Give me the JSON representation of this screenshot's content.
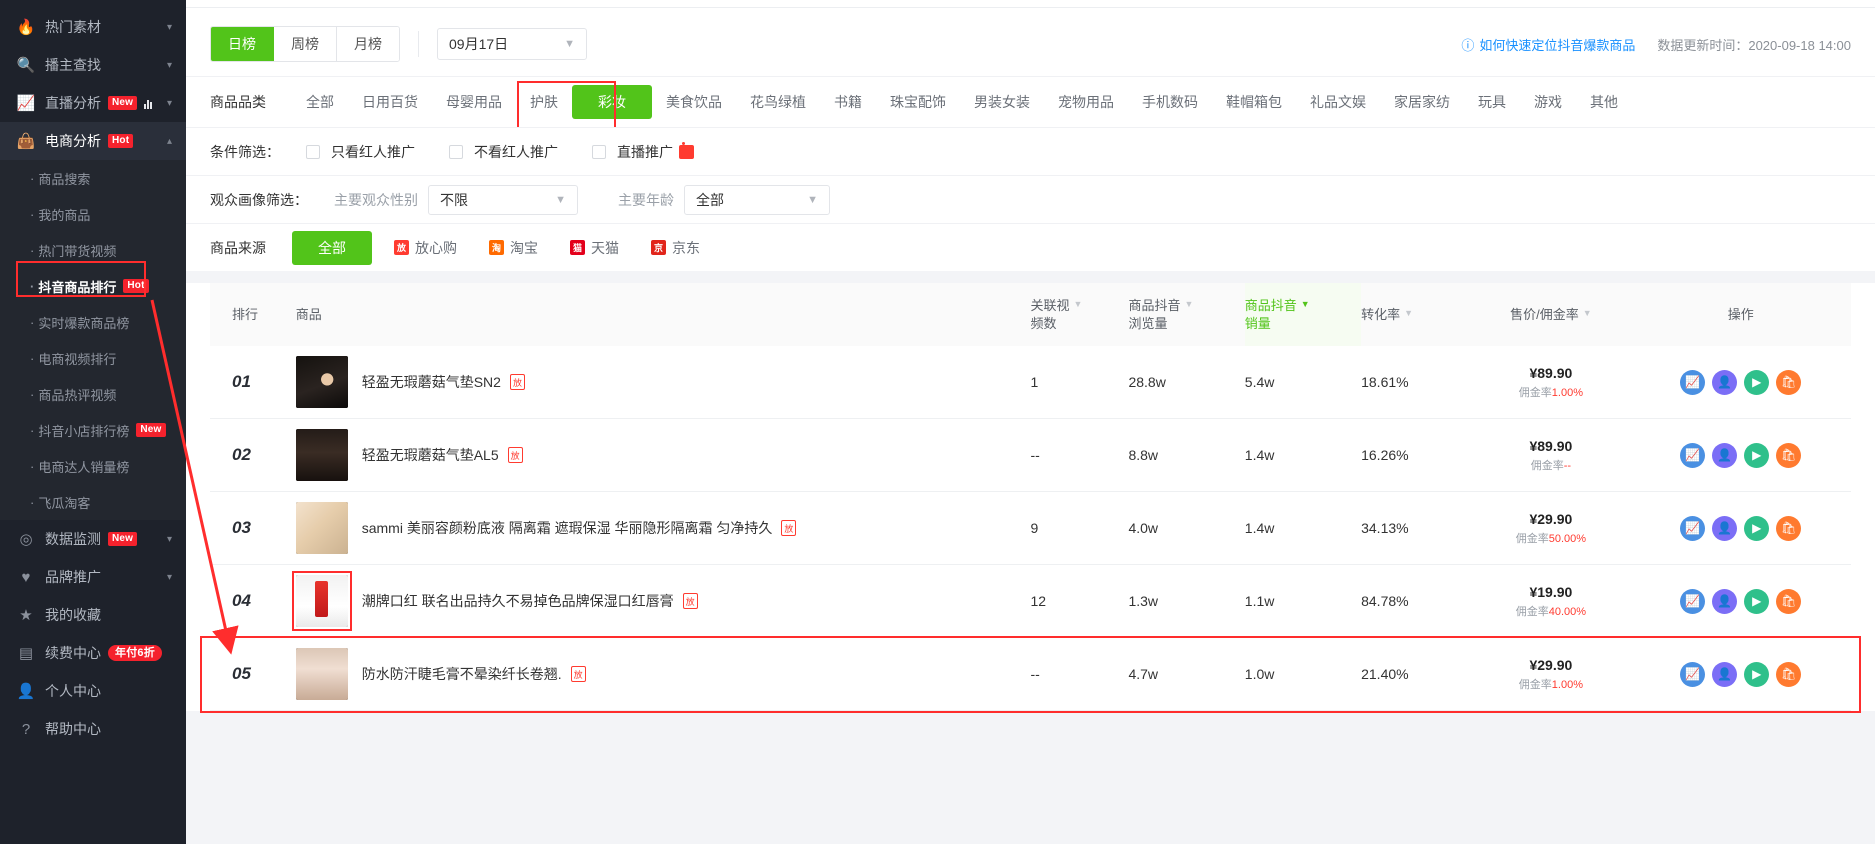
{
  "sidebar": {
    "groups": [
      {
        "label": "热门素材",
        "icon": "flame-icon",
        "badge": "",
        "caret": "▾",
        "active": false
      },
      {
        "label": "播主查找",
        "icon": "search-icon",
        "badge": "",
        "caret": "▾",
        "active": false
      },
      {
        "label": "直播分析",
        "icon": "trend-icon",
        "badge": "New",
        "caret": "▾",
        "active": false
      },
      {
        "label": "电商分析",
        "icon": "bag-icon",
        "badge": "Hot",
        "caret": "▴",
        "active": true
      }
    ],
    "sub_items": [
      {
        "label": "商品搜索",
        "badge": "",
        "selected": false
      },
      {
        "label": "我的商品",
        "badge": "",
        "selected": false
      },
      {
        "label": "热门带货视频",
        "badge": "",
        "selected": false
      },
      {
        "label": "抖音商品排行",
        "badge": "Hot",
        "selected": true
      },
      {
        "label": "实时爆款商品榜",
        "badge": "",
        "selected": false
      },
      {
        "label": "电商视频排行",
        "badge": "",
        "selected": false
      },
      {
        "label": "商品热评视频",
        "badge": "",
        "selected": false
      },
      {
        "label": "抖音小店排行榜",
        "badge": "New",
        "selected": false
      },
      {
        "label": "电商达人销量榜",
        "badge": "",
        "selected": false
      },
      {
        "label": "飞瓜淘客",
        "badge": "",
        "selected": false
      }
    ],
    "bottom_items": [
      {
        "label": "数据监测",
        "icon": "monitor-icon",
        "badge": "New",
        "badge_style": "square",
        "caret": "▾"
      },
      {
        "label": "品牌推广",
        "icon": "shield-icon",
        "badge": "",
        "badge_style": "",
        "caret": "▾"
      },
      {
        "label": "我的收藏",
        "icon": "star-icon",
        "badge": "",
        "badge_style": "",
        "caret": ""
      },
      {
        "label": "续费中心",
        "icon": "card-icon",
        "badge": "年付6折",
        "badge_style": "pill",
        "caret": ""
      },
      {
        "label": "个人中心",
        "icon": "user-icon",
        "badge": "",
        "badge_style": "",
        "caret": ""
      },
      {
        "label": "帮助中心",
        "icon": "question-icon",
        "badge": "",
        "badge_style": "",
        "caret": ""
      }
    ]
  },
  "toolbar": {
    "rank_modes": [
      {
        "label": "日榜",
        "on": true
      },
      {
        "label": "周榜",
        "on": false
      },
      {
        "label": "月榜",
        "on": false
      }
    ],
    "date_value": "09月17日",
    "help_link": "如何快速定位抖音爆款商品",
    "help_icon": "question-circle-icon",
    "update_time": "数据更新时间：2020-09-18 14:00"
  },
  "filters": {
    "category_label": "商品品类",
    "categories": [
      {
        "label": "全部",
        "on": false
      },
      {
        "label": "日用百货",
        "on": false
      },
      {
        "label": "母婴用品",
        "on": false
      },
      {
        "label": "护肤",
        "on": false
      },
      {
        "label": "彩妆",
        "on": true
      },
      {
        "label": "美食饮品",
        "on": false
      },
      {
        "label": "花鸟绿植",
        "on": false
      },
      {
        "label": "书籍",
        "on": false
      },
      {
        "label": "珠宝配饰",
        "on": false
      },
      {
        "label": "男装女装",
        "on": false
      },
      {
        "label": "宠物用品",
        "on": false
      },
      {
        "label": "手机数码",
        "on": false
      },
      {
        "label": "鞋帽箱包",
        "on": false
      },
      {
        "label": "礼品文娱",
        "on": false
      },
      {
        "label": "家居家纺",
        "on": false
      },
      {
        "label": "玩具",
        "on": false
      },
      {
        "label": "游戏",
        "on": false
      },
      {
        "label": "其他",
        "on": false
      }
    ],
    "condition_label": "条件筛选：",
    "conditions": [
      {
        "label": "只看红人推广",
        "checked": false,
        "live_icon": false
      },
      {
        "label": "不看红人推广",
        "checked": false,
        "live_icon": false
      },
      {
        "label": "直播推广",
        "checked": false,
        "live_icon": true
      }
    ],
    "audience_label": "观众画像筛选：",
    "audience_gender_label": "主要观众性别",
    "audience_gender_value": "不限",
    "audience_age_label": "主要年龄",
    "audience_age_value": "全部",
    "source_label": "商品来源",
    "sources": [
      {
        "label": "全部",
        "on": true,
        "icon": "",
        "icon_color": ""
      },
      {
        "label": "放心购",
        "on": false,
        "icon": "放",
        "icon_color": "#ff3b30"
      },
      {
        "label": "淘宝",
        "on": false,
        "icon": "淘",
        "icon_color": "#ff6a00"
      },
      {
        "label": "天猫",
        "on": false,
        "icon": "猫",
        "icon_color": "#e3001b"
      },
      {
        "label": "京东",
        "on": false,
        "icon": "京",
        "icon_color": "#e1251b"
      }
    ]
  },
  "table": {
    "columns": [
      {
        "key": "rank",
        "label": "排行",
        "sortable": false,
        "sorted": false
      },
      {
        "key": "product",
        "label": "商品",
        "sortable": false,
        "sorted": false
      },
      {
        "key": "videos",
        "label": "关联视\n频数",
        "sortable": true,
        "sorted": false
      },
      {
        "key": "views",
        "label": "商品抖音\n浏览量",
        "sortable": true,
        "sorted": false
      },
      {
        "key": "sales",
        "label": "商品抖音\n销量",
        "sortable": true,
        "sorted": true
      },
      {
        "key": "conversion",
        "label": "转化率",
        "sortable": true,
        "sorted": false
      },
      {
        "key": "price",
        "label": "售价/佣金率",
        "sortable": true,
        "sorted": false
      },
      {
        "key": "ops",
        "label": "操作",
        "sortable": false,
        "sorted": false
      }
    ],
    "rows": [
      {
        "rank": "01",
        "thumb_class": "t1",
        "name": "轻盈无瑕蘑菇气垫SN2",
        "shop_tag": "放",
        "videos": "1",
        "views": "28.8w",
        "sales": "5.4w",
        "conversion": "18.61%",
        "price": "¥89.90",
        "commission_prefix": "佣金率",
        "commission": "1.00%",
        "highlight": false
      },
      {
        "rank": "02",
        "thumb_class": "t2",
        "name": "轻盈无瑕蘑菇气垫AL5",
        "shop_tag": "放",
        "videos": "--",
        "views": "8.8w",
        "sales": "1.4w",
        "conversion": "16.26%",
        "price": "¥89.90",
        "commission_prefix": "佣金率",
        "commission": "--",
        "highlight": false
      },
      {
        "rank": "03",
        "thumb_class": "t3",
        "name": "sammi 美丽容颜粉底液 隔离霜 遮瑕保湿 华丽隐形隔离霜 匀净持久",
        "shop_tag": "放",
        "videos": "9",
        "views": "4.0w",
        "sales": "1.4w",
        "conversion": "34.13%",
        "price": "¥29.90",
        "commission_prefix": "佣金率",
        "commission": "50.00%",
        "highlight": false
      },
      {
        "rank": "04",
        "thumb_class": "t4",
        "name": "潮牌口红 联名出品持久不易掉色品牌保湿口红唇膏",
        "shop_tag": "放",
        "videos": "12",
        "views": "1.3w",
        "sales": "1.1w",
        "conversion": "84.78%",
        "price": "¥19.90",
        "commission_prefix": "佣金率",
        "commission": "40.00%",
        "highlight": true
      },
      {
        "rank": "05",
        "thumb_class": "t5",
        "name": "防水防汗睫毛膏不晕染纤长卷翘.",
        "shop_tag": "放",
        "videos": "--",
        "views": "4.7w",
        "sales": "1.0w",
        "conversion": "21.40%",
        "price": "¥29.90",
        "commission_prefix": "佣金率",
        "commission": "1.00%",
        "highlight": true
      }
    ],
    "action_icons": [
      {
        "name": "trend-chart-icon",
        "glyph": "📈",
        "cls": "a-blue"
      },
      {
        "name": "person-icon",
        "glyph": "👤",
        "cls": "a-purple"
      },
      {
        "name": "video-play-icon",
        "glyph": "▶",
        "cls": "a-green"
      },
      {
        "name": "shop-bag-icon",
        "glyph": "🛍",
        "cls": "a-orange"
      }
    ]
  },
  "annotations": {
    "accent_red": "#ff2d2d",
    "accent_green": "#52c41a"
  }
}
